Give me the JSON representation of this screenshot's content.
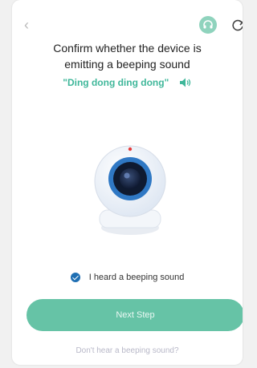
{
  "header": {
    "back_icon": "chevron-left-icon",
    "assist_icon": "headset-icon",
    "refresh_icon": "refresh-icon"
  },
  "title_line1": "Confirm whether the device is",
  "title_line2": "emitting a beeping sound",
  "sound_phrase": "\"Ding dong ding dong\"",
  "speaker_icon": "speaker-icon",
  "confirm_label": "I heard a beeping sound",
  "next_button": "Next Step",
  "help_link": "Don't hear a beeping sound?",
  "colors": {
    "accent": "#66c3a6",
    "phrase": "#3fb79a",
    "check": "#1f6fb3"
  }
}
